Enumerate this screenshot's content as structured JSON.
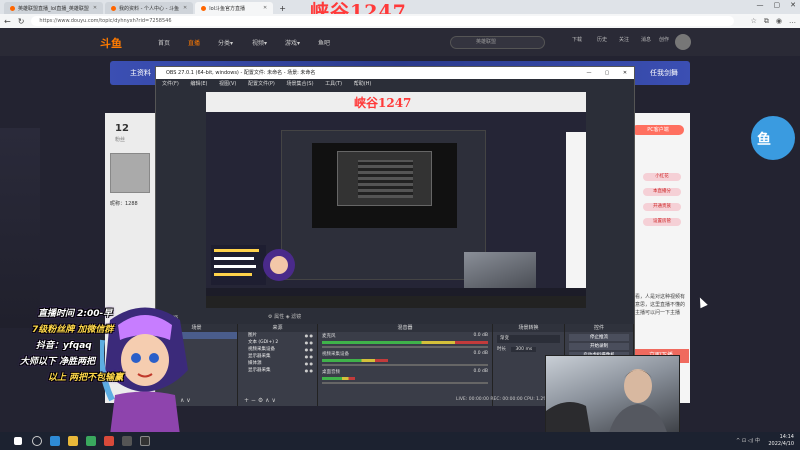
{
  "browser": {
    "tabs": [
      {
        "label": "英雄联盟直播_lol直播_英雄联盟",
        "active": false
      },
      {
        "label": "我的资料 - 个人中心 - 斗鱼",
        "active": false
      },
      {
        "label": "lol斗鱼官方直播",
        "active": true
      }
    ],
    "new_tab": "+",
    "window_controls": [
      "—",
      "▢",
      "✕"
    ],
    "url": "https://www.douyu.com/topic/dyhnyxh?rid=7258546",
    "stream_title": "峡谷1247"
  },
  "douyu": {
    "logo": "斗鱼",
    "nav": [
      "首页",
      "直播",
      "分类▾",
      "视频▾",
      "游戏▾",
      "鱼吧"
    ],
    "search_placeholder": "英雄联盟",
    "header_icons": [
      "下载",
      "历史",
      "关注",
      "消息",
      "创作"
    ],
    "banner_left": "主资料",
    "banner_right": "任我剑舞",
    "count": "12",
    "count_label": "粉丝",
    "user_label": "昵称：1288",
    "pc_button": "PC客户端",
    "pills": [
      "小红花",
      "本直播分",
      "开通贵族",
      "设置房管"
    ],
    "chat_text": "看，人是对这种视频有意思，这里直播不懂的主播可以问一下主播",
    "red_button": "立即下播"
  },
  "obs": {
    "title": "OBS 27.0.1 (64-bit, windows) - 配置文件: 未命名 - 场景: 未命名",
    "menu": [
      "文件(F)",
      "编辑(E)",
      "视图(V)",
      "配置文件(P)",
      "场景集合(S)",
      "工具(T)",
      "帮助(H)"
    ],
    "preview_title": "峡谷1247",
    "scene_info": "未选择源",
    "props_label": "属性",
    "filters_label": "滤镜",
    "docks": {
      "scenes": {
        "title": "场景",
        "items": [
          "场景"
        ]
      },
      "sources": {
        "title": "来源",
        "items": [
          "图片",
          "文本 (GDI+) 2",
          "视频采集设备",
          "显示器采集",
          "媒体源",
          "显示器采集"
        ]
      },
      "mixer": {
        "title": "混音器",
        "rows": [
          {
            "name": "麦克风",
            "db": "0.0 dB"
          },
          {
            "name": "视频采集设备",
            "db": "0.0 dB"
          },
          {
            "name": "桌面音频",
            "db": "0.0 dB"
          }
        ]
      },
      "transitions": {
        "title": "场景转换",
        "type": "渐变",
        "duration_label": "时长",
        "duration": "300 ms"
      },
      "controls": {
        "title": "控件",
        "buttons": [
          "停止推流",
          "开始录制",
          "启动虚拟摄像机",
          "工作室模式",
          "设置",
          "退出"
        ]
      }
    },
    "status": "LIVE: 00:00:00  REC: 00:00:00  CPU: 1.2%, 30.00 fps"
  },
  "overlay": {
    "lines": [
      "直播时间 2:00-早",
      "7级粉丝牌 加微信群",
      "抖音：yfqaq",
      "大师以下 净胜两把",
      "以上 两把不包输赢"
    ]
  },
  "taskbar": {
    "time": "14:14",
    "date": "2022/4/10",
    "tray": "^ ⊡ ◁) 中"
  },
  "colors": {
    "douyu_orange": "#ff7a00",
    "title_red": "#ff3a3a",
    "banner_blue": "#3b4fb3",
    "obs_bg": "#2b2e38"
  }
}
